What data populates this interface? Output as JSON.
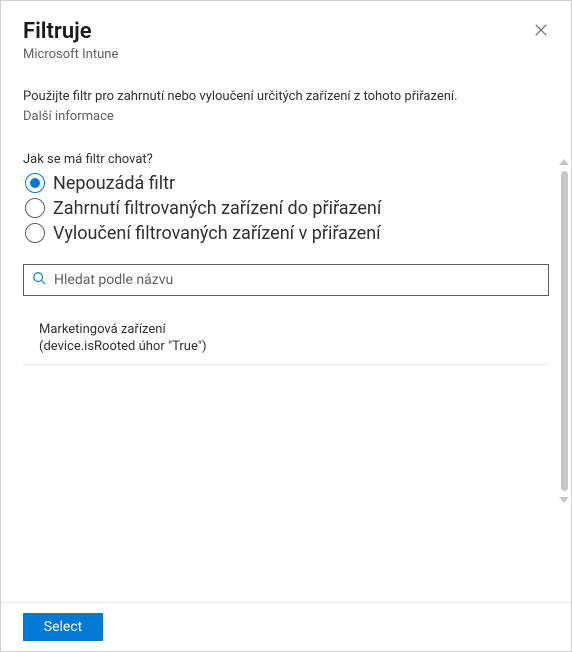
{
  "header": {
    "title": "Filtruje",
    "subtitle": "Microsoft Intune"
  },
  "description": "Použijte filtr pro zahrnutí nebo vyloučení určitých zařízení z tohoto přiřazení.",
  "more_info": "Další informace",
  "question": "Jak se má filtr chovat?",
  "radios": {
    "opt0": "Nepouzádá filtr",
    "opt1": "Zahrnutí filtrovaných zařízení do přiřazení",
    "opt2": "Vyloučení filtrovaných zařízení v přiřazení"
  },
  "search": {
    "placeholder": "Hledat podle názvu"
  },
  "filters": [
    {
      "name": "Marketingová zařízení",
      "rule": "(device.isRooted úhor \"True\")"
    }
  ],
  "footer": {
    "select": "Select"
  }
}
